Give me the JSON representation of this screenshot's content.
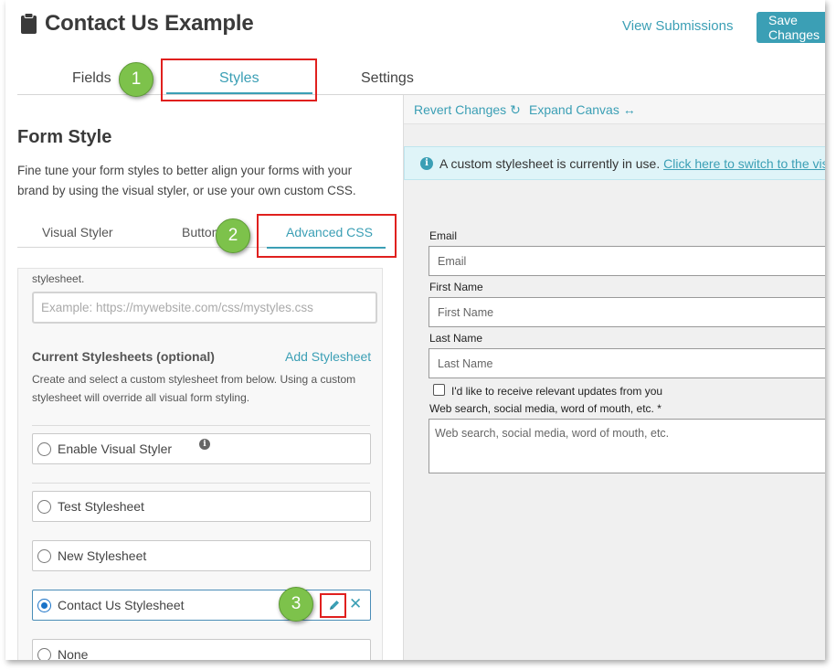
{
  "header": {
    "title": "Contact Us Example",
    "view_submissions": "View Submissions",
    "save_label": "Save Changes"
  },
  "tabs": {
    "fields": "Fields",
    "styles": "Styles",
    "settings": "Settings",
    "active": "Styles"
  },
  "callouts": [
    "1",
    "2",
    "3"
  ],
  "form_style": {
    "title": "Form Style",
    "description": "Fine tune your form styles to better align your forms with your brand by using the visual styler, or use your own custom CSS."
  },
  "subtabs": {
    "visual": "Visual Styler",
    "button": "Button",
    "advanced": "Advanced CSS",
    "active": "Advanced CSS"
  },
  "advanced_css": {
    "stylesheet_tail": "stylesheet.",
    "url_placeholder": "Example: https://mywebsite.com/css/mystyles.css",
    "current_title": "Current Stylesheets (optional)",
    "add_label": "Add Stylesheet",
    "current_desc": "Create and select a custom stylesheet from below. Using a custom stylesheet will override all visual form styling.",
    "options": [
      {
        "label": "Enable Visual Styler",
        "selected": false
      },
      {
        "label": "Test Stylesheet",
        "selected": false
      },
      {
        "label": "New Stylesheet",
        "selected": false
      },
      {
        "label": "Contact Us Stylesheet",
        "selected": true
      },
      {
        "label": "None",
        "selected": false
      }
    ]
  },
  "canvas": {
    "revert": "Revert Changes",
    "expand": "Expand Canvas",
    "notice_text": "A custom stylesheet is currently in use.",
    "notice_link": "Click here to switch to the visual styler"
  },
  "preview_form": {
    "email_label": "Email",
    "email_placeholder": "Email",
    "first_label": "First Name",
    "first_placeholder": "First Name",
    "last_label": "Last Name",
    "last_placeholder": "Last Name",
    "checkbox_label": "I'd like to receive relevant updates from you",
    "source_label": "Web search, social media, word of mouth, etc. *",
    "source_placeholder": "Web search, social media, word of mouth, etc."
  },
  "colors": {
    "accent": "#3b9fb5",
    "callout": "#7dc24b",
    "highlight": "#e0201e",
    "notice_bg": "#dff4f8"
  }
}
